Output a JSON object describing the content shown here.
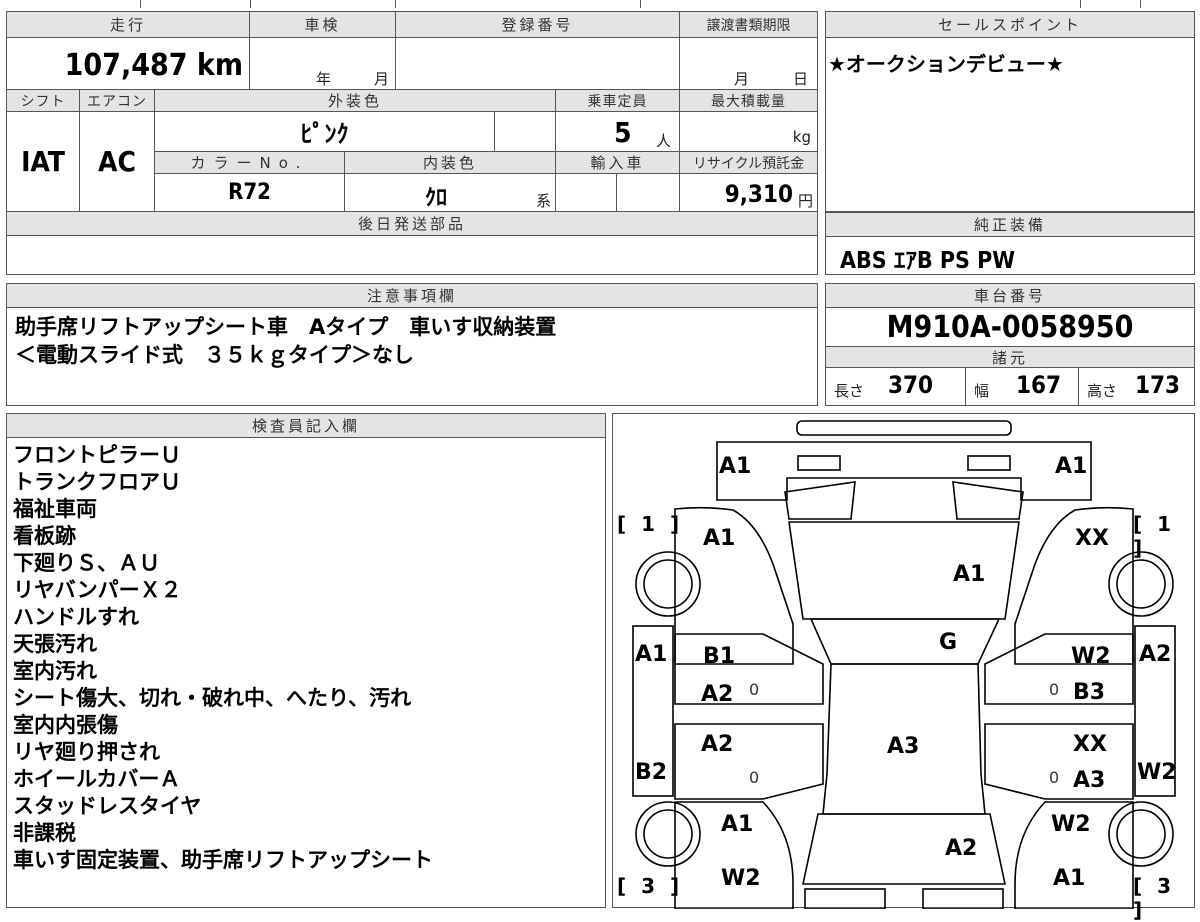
{
  "top_info": {
    "mileage": {
      "header": "走行",
      "value": "107,487 km"
    },
    "shaken": {
      "header": "車検",
      "year_label": "年",
      "month_label": "月"
    },
    "registration": {
      "header": "登録番号"
    },
    "transfer": {
      "header": "譲渡書類期限",
      "month_label": "月",
      "day_label": "日"
    },
    "shift": {
      "header": "シフト",
      "value": "IAT"
    },
    "aircon": {
      "header": "エアコン",
      "value": "AC"
    },
    "exterior_color": {
      "header": "外装色",
      "value": "ﾋﾟﾝｸ"
    },
    "capacity": {
      "header": "乗車定員",
      "value": "5",
      "unit": "人"
    },
    "max_load": {
      "header": "最大積載量",
      "unit": "kg"
    },
    "color_no": {
      "header": "カラーNo.",
      "value": "R72"
    },
    "interior_color": {
      "header": "内装色",
      "value": "ｸﾛ",
      "suffix": "系"
    },
    "import": {
      "header": "輸入車"
    },
    "recycle": {
      "header": "リサイクル預託金",
      "value": "9,310",
      "unit": "円"
    },
    "later_parts": {
      "header": "後日発送部品",
      "value": ""
    }
  },
  "sales_point": {
    "header": "セールスポイント",
    "text": "★オークションデビュー★"
  },
  "standard_equipment": {
    "header": "純正装備",
    "text": "ABS ｴｱB PS PW"
  },
  "notes": {
    "header": "注意事項欄",
    "lines": [
      "助手席リフトアップシート車　Aタイプ　車いす収納装置",
      "＜電動スライド式　３５ｋｇタイプ＞なし"
    ]
  },
  "chassis": {
    "header": "車台番号",
    "value": "M910A-0058950"
  },
  "specs": {
    "header": "諸元",
    "length_label": "長さ",
    "length": "370",
    "width_label": "幅",
    "width": "167",
    "height_label": "高さ",
    "height": "173"
  },
  "inspector": {
    "header": "検査員記入欄",
    "lines": [
      "フロントピラーＵ",
      "トランクフロアＵ",
      "福祉車両",
      "看板跡",
      "下廻りＳ、ＡＵ",
      "リヤバンパーＸ２",
      "ハンドルすれ",
      "天張汚れ",
      "室内汚れ",
      "シート傷大、切れ・破れ中、へたり、汚れ",
      "室内内張傷",
      "リヤ廻り押され",
      "ホイールカバーＡ",
      "スタッドレスタイヤ",
      "非課税",
      "車いす固定装置、助手席リフトアップシート"
    ]
  },
  "diagram": {
    "marks": {
      "front_left": "A1",
      "front_right": "A1",
      "fender_left": "A1",
      "fender_right": "XX",
      "hood": "A1",
      "windshield": "G",
      "pillar_left": "A1",
      "pillar_right": "A2",
      "door_fl_1": "B1",
      "door_fl_2": "A2",
      "door_fr_1": "W2",
      "door_fr_2": "B3",
      "door_rl": "A2",
      "door_rr": "XX",
      "roof": "A3",
      "side_rl": "B2",
      "side_rr": "W2",
      "quarter_rr": "A3",
      "rear_fender_left": "A1",
      "rear_fender_right": "W2",
      "rear_left": "W2",
      "rear_right": "A1",
      "rear_center": "A2",
      "zero": "0"
    },
    "brackets": {
      "front_left": "[ 1 ]",
      "front_right": "[ 1 ]",
      "rear_left": "[ 3 ]",
      "rear_right": "[ 3 ]"
    }
  }
}
